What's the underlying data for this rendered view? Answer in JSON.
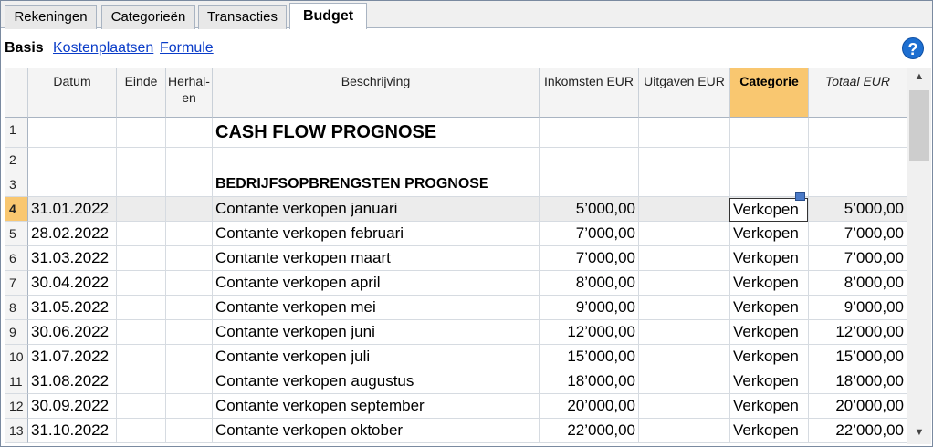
{
  "tabs": [
    {
      "label": "Rekeningen",
      "active": false
    },
    {
      "label": "Categorieën",
      "active": false
    },
    {
      "label": "Transacties",
      "active": false
    },
    {
      "label": "Budget",
      "active": true
    }
  ],
  "subnav": {
    "basis": "Basis",
    "kostenplaatsen": "Kostenplaatsen",
    "formule": "Formule"
  },
  "help_icon": "?",
  "columns": {
    "datum": "Datum",
    "einde": "Einde",
    "herhalen": "Herhal-\nen",
    "beschrijving": "Beschrijving",
    "inkomsten": "Inkomsten EUR",
    "uitgaven": "Uitgaven EUR",
    "categorie": "Categorie",
    "totaal": "Totaal EUR"
  },
  "rows": [
    {
      "nr": "1",
      "datum": "",
      "beschrijving": "CASH FLOW PROGNOSE",
      "inkomsten": "",
      "categorie": "",
      "totaal": "",
      "style": "title1"
    },
    {
      "nr": "2",
      "datum": "",
      "beschrijving": "",
      "inkomsten": "",
      "categorie": "",
      "totaal": ""
    },
    {
      "nr": "3",
      "datum": "",
      "beschrijving": "BEDRIJFSOPBRENGSTEN PROGNOSE",
      "inkomsten": "",
      "categorie": "",
      "totaal": "",
      "style": "title2"
    },
    {
      "nr": "4",
      "datum": "31.01.2022",
      "beschrijving": "Contante verkopen januari",
      "inkomsten": "5’000,00",
      "categorie": "Verkopen",
      "totaal": "5’000,00",
      "selected": true
    },
    {
      "nr": "5",
      "datum": "28.02.2022",
      "beschrijving": "Contante verkopen februari",
      "inkomsten": "7’000,00",
      "categorie": "Verkopen",
      "totaal": "7’000,00"
    },
    {
      "nr": "6",
      "datum": "31.03.2022",
      "beschrijving": "Contante verkopen maart",
      "inkomsten": "7’000,00",
      "categorie": "Verkopen",
      "totaal": "7’000,00"
    },
    {
      "nr": "7",
      "datum": "30.04.2022",
      "beschrijving": "Contante verkopen april",
      "inkomsten": "8’000,00",
      "categorie": "Verkopen",
      "totaal": "8’000,00"
    },
    {
      "nr": "8",
      "datum": "31.05.2022",
      "beschrijving": "Contante verkopen mei",
      "inkomsten": "9’000,00",
      "categorie": "Verkopen",
      "totaal": "9’000,00"
    },
    {
      "nr": "9",
      "datum": "30.06.2022",
      "beschrijving": "Contante verkopen juni",
      "inkomsten": "12’000,00",
      "categorie": "Verkopen",
      "totaal": "12’000,00"
    },
    {
      "nr": "10",
      "datum": "31.07.2022",
      "beschrijving": "Contante verkopen juli",
      "inkomsten": "15’000,00",
      "categorie": "Verkopen",
      "totaal": "15’000,00"
    },
    {
      "nr": "11",
      "datum": "31.08.2022",
      "beschrijving": "Contante verkopen augustus",
      "inkomsten": "18’000,00",
      "categorie": "Verkopen",
      "totaal": "18’000,00"
    },
    {
      "nr": "12",
      "datum": "30.09.2022",
      "beschrijving": "Contante verkopen september",
      "inkomsten": "20’000,00",
      "categorie": "Verkopen",
      "totaal": "20’000,00"
    },
    {
      "nr": "13",
      "datum": "31.10.2022",
      "beschrijving": "Contante verkopen oktober",
      "inkomsten": "22’000,00",
      "categorie": "Verkopen",
      "totaal": "22’000,00"
    }
  ],
  "colors": {
    "accent": "#f9c770",
    "link": "#0a3cc8",
    "help": "#1d6fd1"
  }
}
